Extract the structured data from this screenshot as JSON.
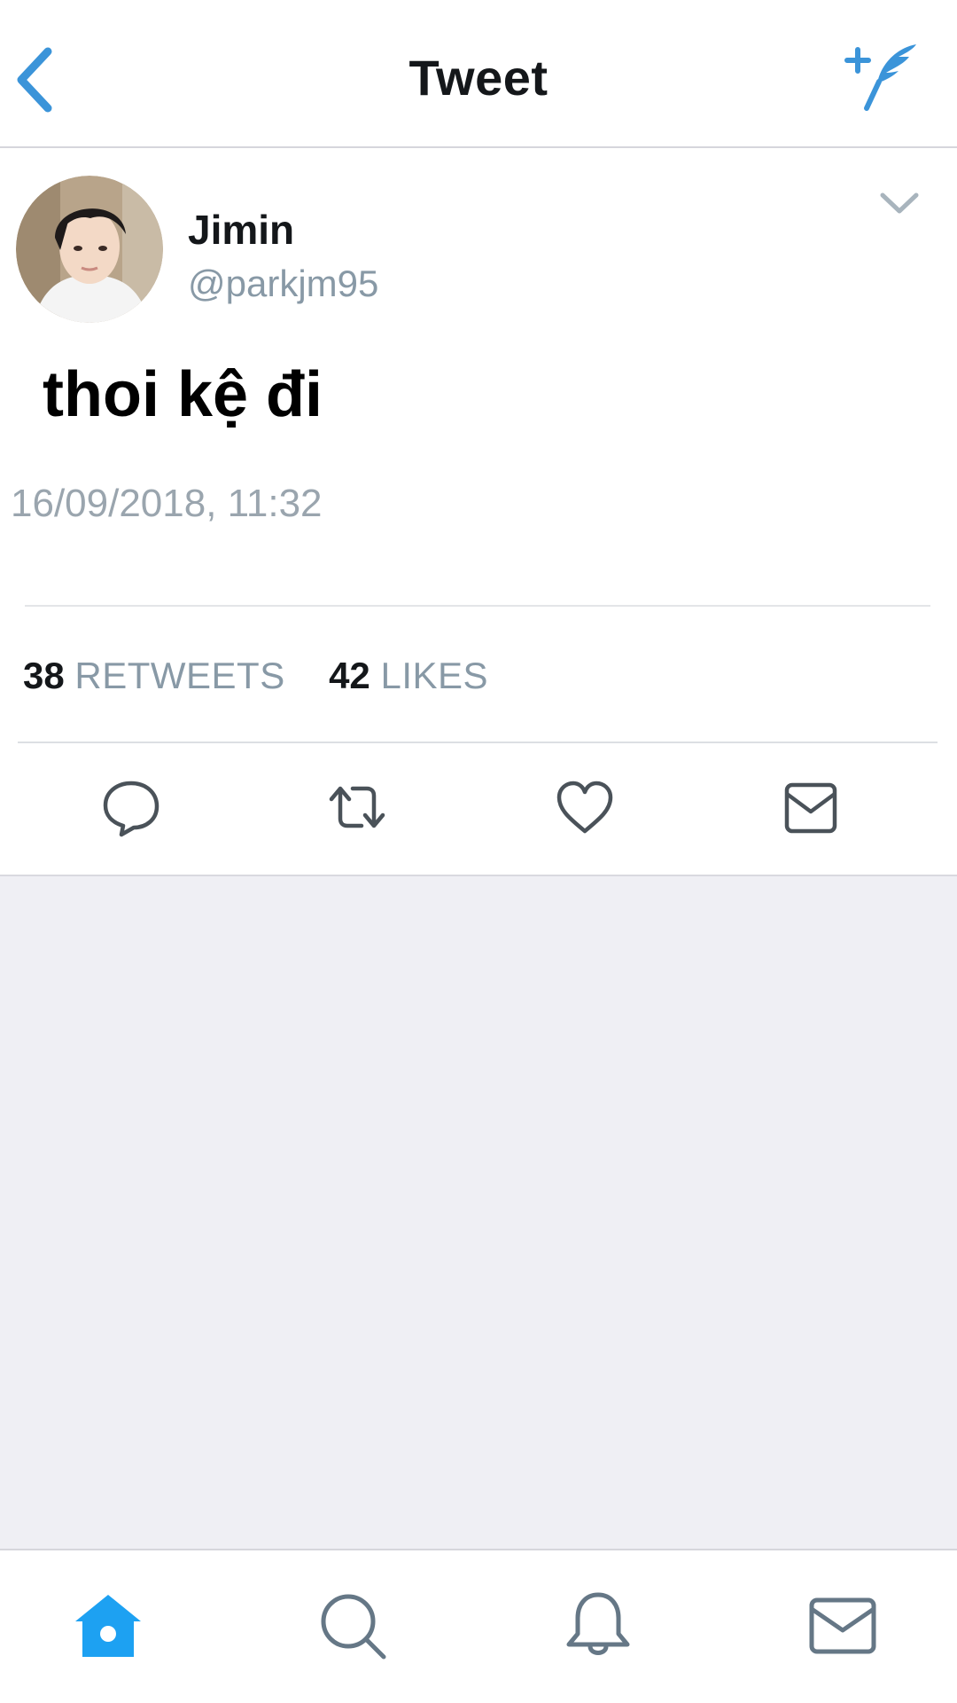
{
  "header": {
    "title": "Tweet",
    "back_icon": "chevron-left-icon",
    "compose_icon": "compose-tweet-icon",
    "accent_color": "#3b94d9"
  },
  "tweet": {
    "author": {
      "display_name": "Jimin",
      "handle": "@parkjm95"
    },
    "text": "thoi kệ đi",
    "timestamp": "16/09/2018, 11:32",
    "stats": {
      "retweets_count": "38",
      "retweets_label": "RETWEETS",
      "likes_count": "42",
      "likes_label": "LIKES"
    },
    "actions": [
      "reply-icon",
      "retweet-icon",
      "like-icon",
      "direct-message-icon"
    ]
  },
  "tabbar": {
    "tabs": [
      "home-icon",
      "search-icon",
      "notifications-icon",
      "messages-icon"
    ],
    "active_tab": "home-icon",
    "active_color": "#1da1f2",
    "inactive_color": "#657786"
  }
}
